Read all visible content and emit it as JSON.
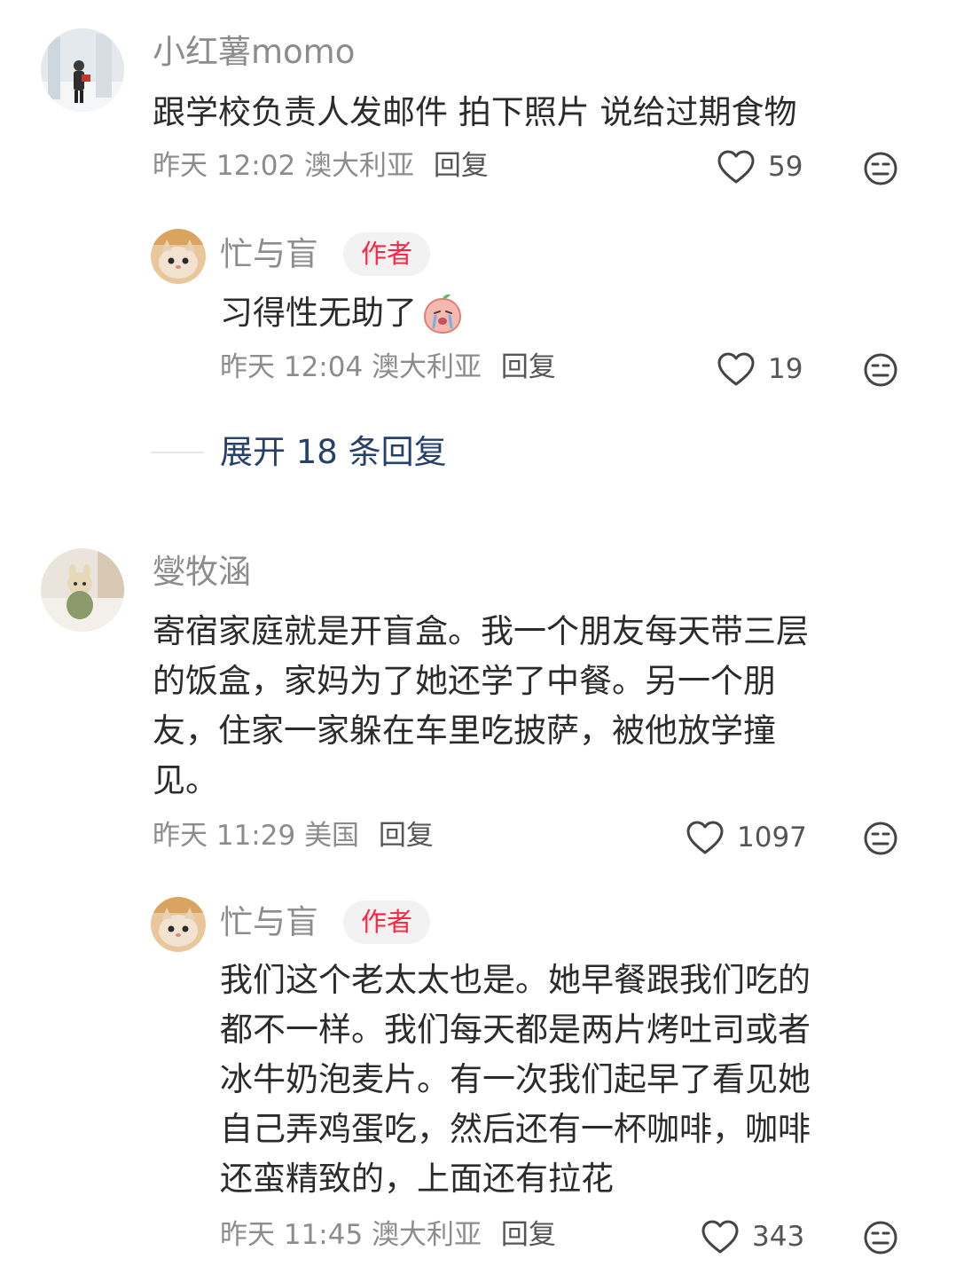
{
  "comments": [
    {
      "user": "小红薯momo",
      "text": "跟学校负责人发邮件 拍下照片 说给过期食物",
      "time": "昨天 12:02",
      "location": "澳大利亚",
      "reply_label": "回复",
      "likes": "59",
      "reply": {
        "user": "忙与盲",
        "badge": "作者",
        "text": "习得性无助了",
        "time": "昨天 12:04",
        "location": "澳大利亚",
        "reply_label": "回复",
        "likes": "19"
      },
      "expand_label": "展开 18 条回复"
    },
    {
      "user": "燮牧涵",
      "text_lines": [
        "寄宿家庭就是开盲盒。我一个朋友每天带三层",
        "的饭盒，家妈为了她还学了中餐。另一个朋",
        "友，住家一家躲在车里吃披萨，被他放学撞",
        "见。"
      ],
      "time": "昨天 11:29",
      "location": "美国",
      "reply_label": "回复",
      "likes": "1097",
      "reply": {
        "user": "忙与盲",
        "badge": "作者",
        "text_lines": [
          "我们这个老太太也是。她早餐跟我们吃的",
          "都不一样。我们每天都是两片烤吐司或者",
          "冰牛奶泡麦片。有一次我们起早了看见她",
          "自己弄鸡蛋吃，然后还有一杯咖啡，咖啡",
          "还蛮精致的，上面还有拉花"
        ],
        "time": "昨天 11:45",
        "location": "澳大利亚",
        "reply_label": "回复",
        "likes": "343"
      }
    }
  ],
  "colors": {
    "accent": "#ff2442",
    "expand": "#25406b",
    "meta": "#8c8c8c"
  },
  "icons": {
    "like": "heart-outline-icon",
    "dislike": "neutral-face-icon",
    "reply_emoji": "crying-peach-emoji-icon"
  }
}
